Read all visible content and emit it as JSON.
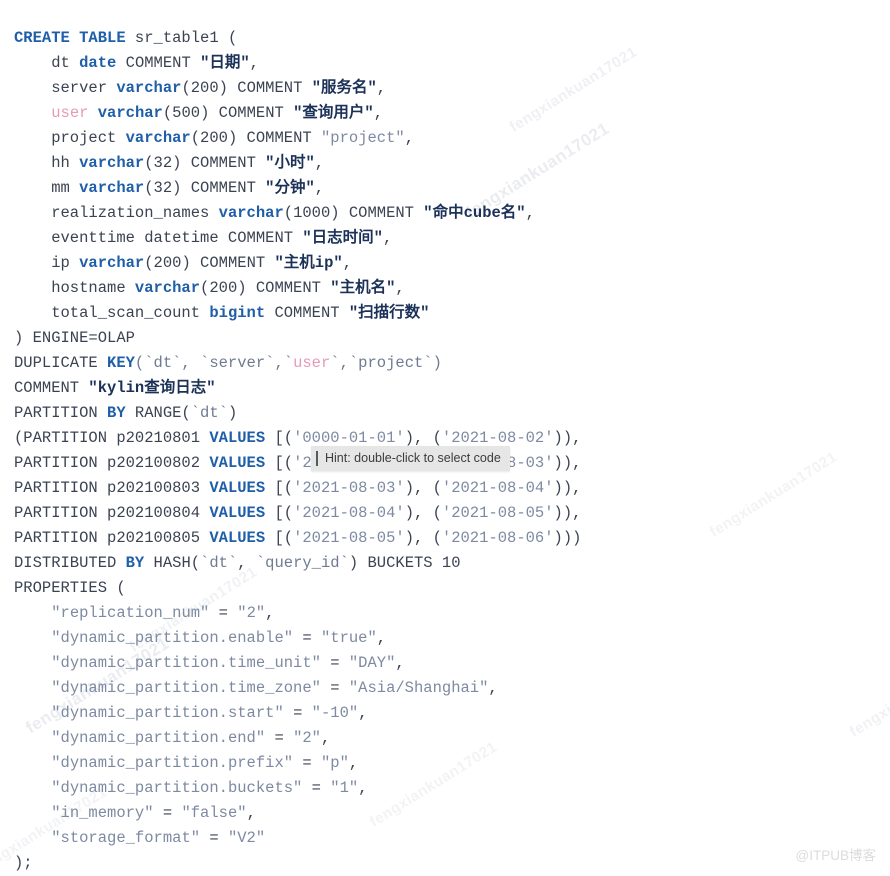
{
  "language": "sql",
  "colors": {
    "background": "#ffffff",
    "default_text": "#3b4352",
    "keyword": "#1f5fa9",
    "string_ascii": "#7d8aa1",
    "string_cjk": "#1b3157",
    "identifier_highlight": "#e49ab8",
    "backtick_identifier": "#6e7b91",
    "tooltip_background": "#e6e6e6",
    "tooltip_text": "#3c3c3c",
    "watermark": "#dcdcdc"
  },
  "tooltip": {
    "text": "Hint: double-click to select code",
    "caret": "text-cursor"
  },
  "watermark": {
    "corner_text": "@ITPUB博客",
    "diagonal_text": "fengxiankuan17021"
  },
  "code_lines": [
    [
      {
        "t": "CREATE TABLE",
        "c": "kw"
      },
      {
        "t": " sr_table1 (",
        "c": "plain"
      }
    ],
    [
      {
        "t": "    dt ",
        "c": "plain"
      },
      {
        "t": "date",
        "c": "kw"
      },
      {
        "t": " COMMENT ",
        "c": "plain"
      },
      {
        "t": "\"日期\"",
        "c": "strcn"
      },
      {
        "t": ",",
        "c": "plain"
      }
    ],
    [
      {
        "t": "    server ",
        "c": "plain"
      },
      {
        "t": "varchar",
        "c": "kw"
      },
      {
        "t": "(200) COMMENT ",
        "c": "plain"
      },
      {
        "t": "\"服务名\"",
        "c": "strcn"
      },
      {
        "t": ",",
        "c": "plain"
      }
    ],
    [
      {
        "t": "    ",
        "c": "plain"
      },
      {
        "t": "user",
        "c": "pink"
      },
      {
        "t": " ",
        "c": "plain"
      },
      {
        "t": "varchar",
        "c": "kw"
      },
      {
        "t": "(500) COMMENT ",
        "c": "plain"
      },
      {
        "t": "\"查询用户\"",
        "c": "strcn"
      },
      {
        "t": ",",
        "c": "plain"
      }
    ],
    [
      {
        "t": "    project ",
        "c": "plain"
      },
      {
        "t": "varchar",
        "c": "kw"
      },
      {
        "t": "(200) COMMENT ",
        "c": "plain"
      },
      {
        "t": "\"project\"",
        "c": "str"
      },
      {
        "t": ",",
        "c": "plain"
      }
    ],
    [
      {
        "t": "    hh ",
        "c": "plain"
      },
      {
        "t": "varchar",
        "c": "kw"
      },
      {
        "t": "(32) COMMENT ",
        "c": "plain"
      },
      {
        "t": "\"小时\"",
        "c": "strcn"
      },
      {
        "t": ",",
        "c": "plain"
      }
    ],
    [
      {
        "t": "    mm ",
        "c": "plain"
      },
      {
        "t": "varchar",
        "c": "kw"
      },
      {
        "t": "(32) COMMENT ",
        "c": "plain"
      },
      {
        "t": "\"分钟\"",
        "c": "strcn"
      },
      {
        "t": ",",
        "c": "plain"
      }
    ],
    [
      {
        "t": "    realization_names ",
        "c": "plain"
      },
      {
        "t": "varchar",
        "c": "kw"
      },
      {
        "t": "(1000) COMMENT ",
        "c": "plain"
      },
      {
        "t": "\"命中cube名\"",
        "c": "strcn"
      },
      {
        "t": ",",
        "c": "plain"
      }
    ],
    [
      {
        "t": "    eventtime datetime COMMENT ",
        "c": "plain"
      },
      {
        "t": "\"日志时间\"",
        "c": "strcn"
      },
      {
        "t": ",",
        "c": "plain"
      }
    ],
    [
      {
        "t": "    ip ",
        "c": "plain"
      },
      {
        "t": "varchar",
        "c": "kw"
      },
      {
        "t": "(200) COMMENT ",
        "c": "plain"
      },
      {
        "t": "\"主机ip\"",
        "c": "strcn"
      },
      {
        "t": ",",
        "c": "plain"
      }
    ],
    [
      {
        "t": "    hostname ",
        "c": "plain"
      },
      {
        "t": "varchar",
        "c": "kw"
      },
      {
        "t": "(200) COMMENT ",
        "c": "plain"
      },
      {
        "t": "\"主机名\"",
        "c": "strcn"
      },
      {
        "t": ",",
        "c": "plain"
      }
    ],
    [
      {
        "t": "    total_scan_count ",
        "c": "plain"
      },
      {
        "t": "bigint",
        "c": "kw"
      },
      {
        "t": " COMMENT ",
        "c": "plain"
      },
      {
        "t": "\"扫描行数\"",
        "c": "strcn"
      }
    ],
    [
      {
        "t": ") ENGINE=OLAP",
        "c": "plain"
      }
    ],
    [
      {
        "t": "DUPLICATE ",
        "c": "plain"
      },
      {
        "t": "KEY",
        "c": "kw"
      },
      {
        "t": "(`dt`, `server`,`",
        "c": "tick"
      },
      {
        "t": "user",
        "c": "pink"
      },
      {
        "t": "`,`project`)",
        "c": "tick"
      }
    ],
    [
      {
        "t": "COMMENT ",
        "c": "plain"
      },
      {
        "t": "\"kylin查询日志\"",
        "c": "strcn"
      }
    ],
    [
      {
        "t": "PARTITION ",
        "c": "plain"
      },
      {
        "t": "BY",
        "c": "kw"
      },
      {
        "t": " RANGE(",
        "c": "plain"
      },
      {
        "t": "`dt`",
        "c": "tick"
      },
      {
        "t": ")",
        "c": "plain"
      }
    ],
    [
      {
        "t": "(PARTITION p20210801 ",
        "c": "plain"
      },
      {
        "t": "VALUES",
        "c": "kw"
      },
      {
        "t": " [(",
        "c": "plain"
      },
      {
        "t": "'0000-01-01'",
        "c": "str"
      },
      {
        "t": "), (",
        "c": "plain"
      },
      {
        "t": "'2021-08-02'",
        "c": "str"
      },
      {
        "t": ")),",
        "c": "plain"
      }
    ],
    [
      {
        "t": "PARTITION p202100802 ",
        "c": "plain"
      },
      {
        "t": "VALUES",
        "c": "kw"
      },
      {
        "t": " [(",
        "c": "plain"
      },
      {
        "t": "'2021-08-02'",
        "c": "str"
      },
      {
        "t": "), (",
        "c": "plain"
      },
      {
        "t": "'2021-08-03'",
        "c": "str"
      },
      {
        "t": ")),",
        "c": "plain"
      }
    ],
    [
      {
        "t": "PARTITION p202100803 ",
        "c": "plain"
      },
      {
        "t": "VALUES",
        "c": "kw"
      },
      {
        "t": " [(",
        "c": "plain"
      },
      {
        "t": "'2021-08-03'",
        "c": "str"
      },
      {
        "t": "), (",
        "c": "plain"
      },
      {
        "t": "'2021-08-04'",
        "c": "str"
      },
      {
        "t": ")),",
        "c": "plain"
      }
    ],
    [
      {
        "t": "PARTITION p202100804 ",
        "c": "plain"
      },
      {
        "t": "VALUES",
        "c": "kw"
      },
      {
        "t": " [(",
        "c": "plain"
      },
      {
        "t": "'2021-08-04'",
        "c": "str"
      },
      {
        "t": "), (",
        "c": "plain"
      },
      {
        "t": "'2021-08-05'",
        "c": "str"
      },
      {
        "t": ")),",
        "c": "plain"
      }
    ],
    [
      {
        "t": "PARTITION p202100805 ",
        "c": "plain"
      },
      {
        "t": "VALUES",
        "c": "kw"
      },
      {
        "t": " [(",
        "c": "plain"
      },
      {
        "t": "'2021-08-05'",
        "c": "str"
      },
      {
        "t": "), (",
        "c": "plain"
      },
      {
        "t": "'2021-08-06'",
        "c": "str"
      },
      {
        "t": ")))",
        "c": "plain"
      }
    ],
    [
      {
        "t": "DISTRIBUTED ",
        "c": "plain"
      },
      {
        "t": "BY",
        "c": "kw"
      },
      {
        "t": " HASH(",
        "c": "plain"
      },
      {
        "t": "`dt`",
        "c": "tick"
      },
      {
        "t": ", ",
        "c": "plain"
      },
      {
        "t": "`query_id`",
        "c": "tick"
      },
      {
        "t": ") BUCKETS 10",
        "c": "plain"
      }
    ],
    [
      {
        "t": "PROPERTIES (",
        "c": "plain"
      }
    ],
    [
      {
        "t": "    ",
        "c": "plain"
      },
      {
        "t": "\"replication_num\"",
        "c": "str"
      },
      {
        "t": " = ",
        "c": "plain"
      },
      {
        "t": "\"2\"",
        "c": "str"
      },
      {
        "t": ",",
        "c": "plain"
      }
    ],
    [
      {
        "t": "    ",
        "c": "plain"
      },
      {
        "t": "\"dynamic_partition.enable\"",
        "c": "str"
      },
      {
        "t": " = ",
        "c": "plain"
      },
      {
        "t": "\"true\"",
        "c": "str"
      },
      {
        "t": ",",
        "c": "plain"
      }
    ],
    [
      {
        "t": "    ",
        "c": "plain"
      },
      {
        "t": "\"dynamic_partition.time_unit\"",
        "c": "str"
      },
      {
        "t": " = ",
        "c": "plain"
      },
      {
        "t": "\"DAY\"",
        "c": "str"
      },
      {
        "t": ",",
        "c": "plain"
      }
    ],
    [
      {
        "t": "    ",
        "c": "plain"
      },
      {
        "t": "\"dynamic_partition.time_zone\"",
        "c": "str"
      },
      {
        "t": " = ",
        "c": "plain"
      },
      {
        "t": "\"Asia/Shanghai\"",
        "c": "str"
      },
      {
        "t": ",",
        "c": "plain"
      }
    ],
    [
      {
        "t": "    ",
        "c": "plain"
      },
      {
        "t": "\"dynamic_partition.start\"",
        "c": "str"
      },
      {
        "t": " = ",
        "c": "plain"
      },
      {
        "t": "\"-10\"",
        "c": "str"
      },
      {
        "t": ",",
        "c": "plain"
      }
    ],
    [
      {
        "t": "    ",
        "c": "plain"
      },
      {
        "t": "\"dynamic_partition.end\"",
        "c": "str"
      },
      {
        "t": " = ",
        "c": "plain"
      },
      {
        "t": "\"2\"",
        "c": "str"
      },
      {
        "t": ",",
        "c": "plain"
      }
    ],
    [
      {
        "t": "    ",
        "c": "plain"
      },
      {
        "t": "\"dynamic_partition.prefix\"",
        "c": "str"
      },
      {
        "t": " = ",
        "c": "plain"
      },
      {
        "t": "\"p\"",
        "c": "str"
      },
      {
        "t": ",",
        "c": "plain"
      }
    ],
    [
      {
        "t": "    ",
        "c": "plain"
      },
      {
        "t": "\"dynamic_partition.buckets\"",
        "c": "str"
      },
      {
        "t": " = ",
        "c": "plain"
      },
      {
        "t": "\"1\"",
        "c": "str"
      },
      {
        "t": ",",
        "c": "plain"
      }
    ],
    [
      {
        "t": "    ",
        "c": "plain"
      },
      {
        "t": "\"in_memory\"",
        "c": "str"
      },
      {
        "t": " = ",
        "c": "plain"
      },
      {
        "t": "\"false\"",
        "c": "str"
      },
      {
        "t": ",",
        "c": "plain"
      }
    ],
    [
      {
        "t": "    ",
        "c": "plain"
      },
      {
        "t": "\"storage_format\"",
        "c": "str"
      },
      {
        "t": " = ",
        "c": "plain"
      },
      {
        "t": "\"V2\"",
        "c": "str"
      }
    ],
    [
      {
        "t": ");",
        "c": "plain"
      }
    ]
  ]
}
